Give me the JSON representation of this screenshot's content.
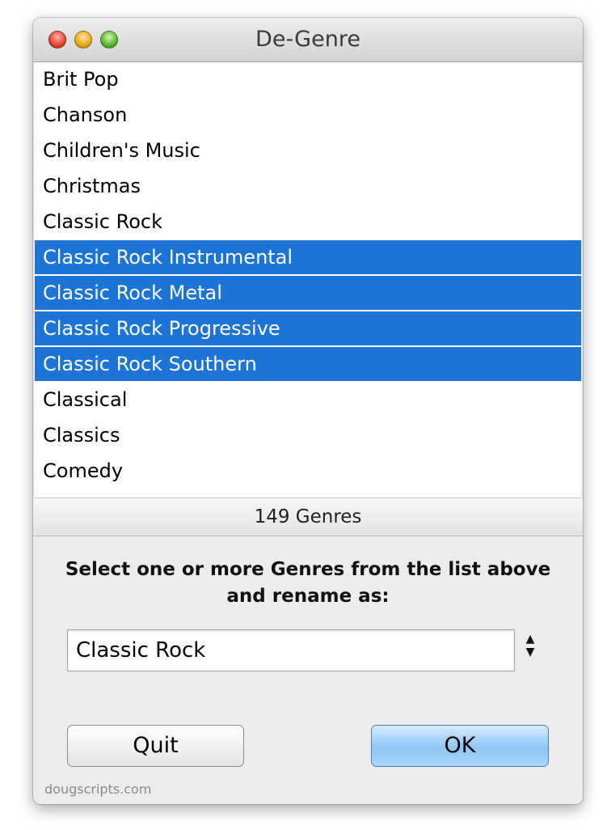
{
  "window": {
    "title": "De-Genre"
  },
  "genre_list": {
    "items": [
      {
        "label": "Brit Pop",
        "selected": false
      },
      {
        "label": "Chanson",
        "selected": false
      },
      {
        "label": "Children's Music",
        "selected": false
      },
      {
        "label": "Christmas",
        "selected": false
      },
      {
        "label": "Classic Rock",
        "selected": false
      },
      {
        "label": "Classic Rock Instrumental",
        "selected": true
      },
      {
        "label": "Classic Rock Metal",
        "selected": true
      },
      {
        "label": "Classic Rock Progressive",
        "selected": true
      },
      {
        "label": "Classic Rock Southern",
        "selected": true
      },
      {
        "label": "Classical",
        "selected": false
      },
      {
        "label": "Classics",
        "selected": false
      },
      {
        "label": "Comedy",
        "selected": false
      }
    ],
    "count_label": "149 Genres",
    "selection_color": "#1c74d6"
  },
  "rename": {
    "prompt": "Select one or more Genres from the list above and rename as:",
    "value": "Classic Rock",
    "stepper_up": "▲",
    "stepper_down": "▼"
  },
  "buttons": {
    "quit_label": "Quit",
    "ok_label": "OK"
  },
  "footer": {
    "credit": "dougscripts.com"
  }
}
